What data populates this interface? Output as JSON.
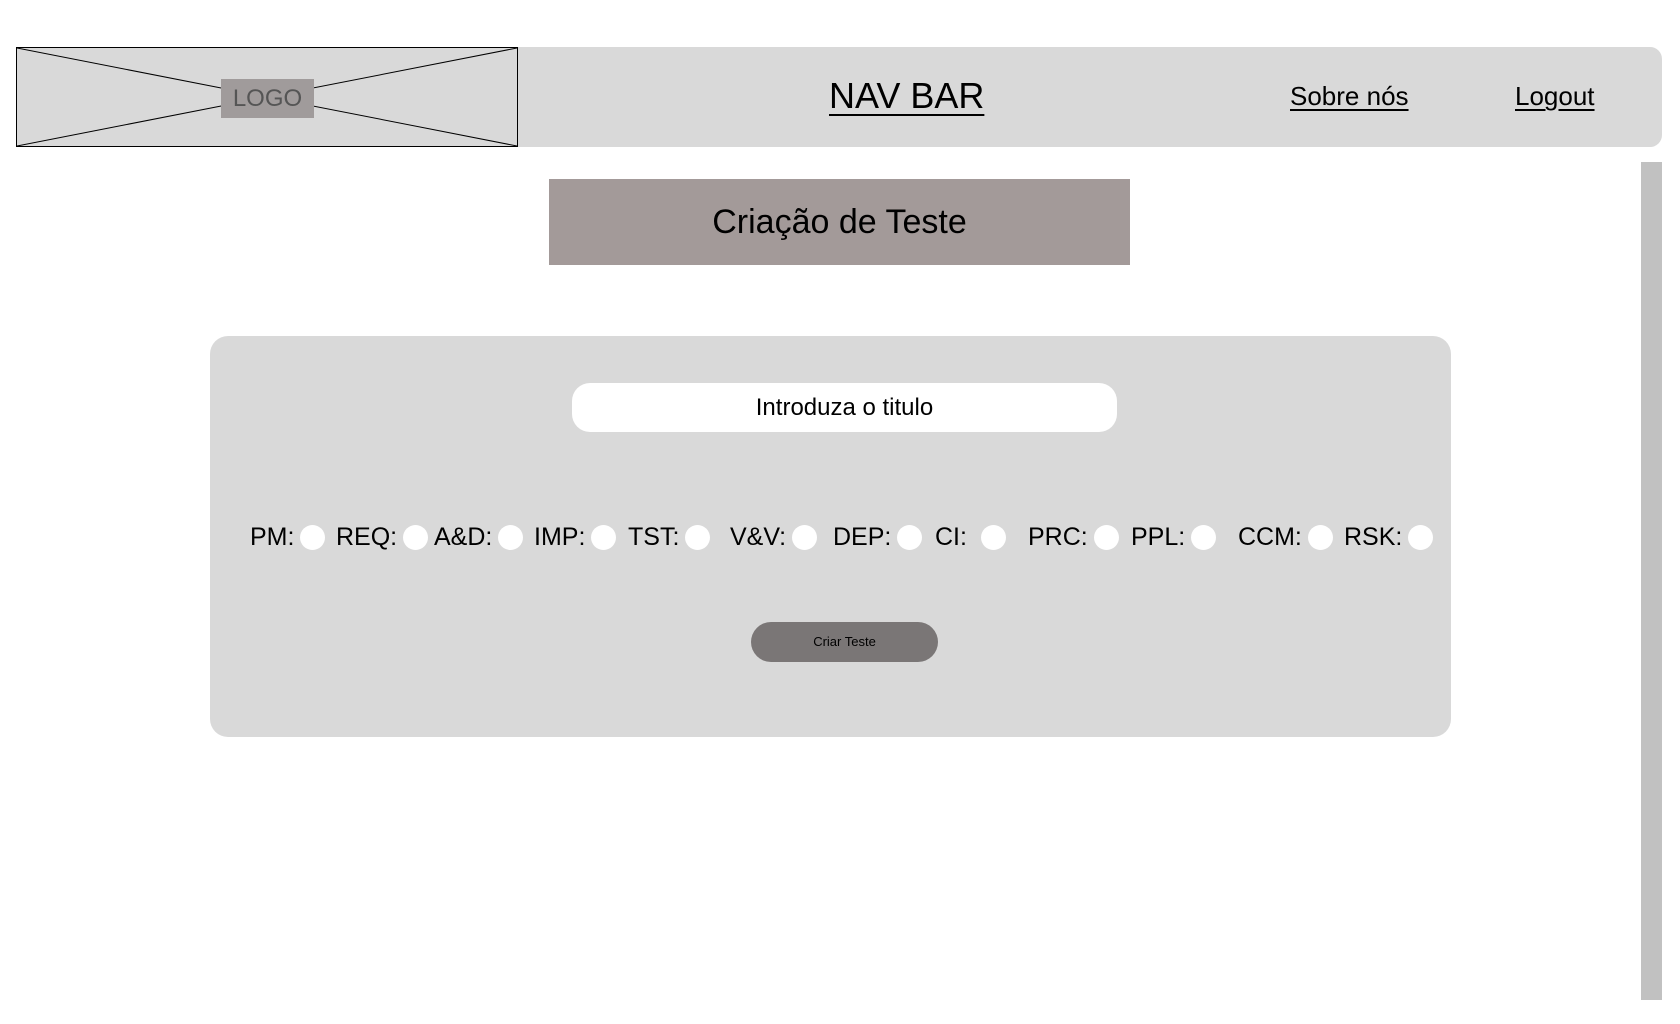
{
  "navbar": {
    "logo_text": "LOGO",
    "title": "NAV BAR",
    "about_link": "Sobre nós",
    "logout_link": "Logout"
  },
  "page": {
    "title": "Criação de Teste"
  },
  "form": {
    "title_placeholder": "Introduza o titulo",
    "areas": [
      {
        "label": "PM:"
      },
      {
        "label": "REQ:"
      },
      {
        "label": "A&D:"
      },
      {
        "label": "IMP:"
      },
      {
        "label": "TST:"
      },
      {
        "label": "V&V:"
      },
      {
        "label": "DEP:"
      },
      {
        "label": "CI:"
      },
      {
        "label": "PRC:"
      },
      {
        "label": "PPL:"
      },
      {
        "label": "CCM:"
      },
      {
        "label": "RSK:"
      }
    ],
    "submit_label": "Criar Teste"
  }
}
